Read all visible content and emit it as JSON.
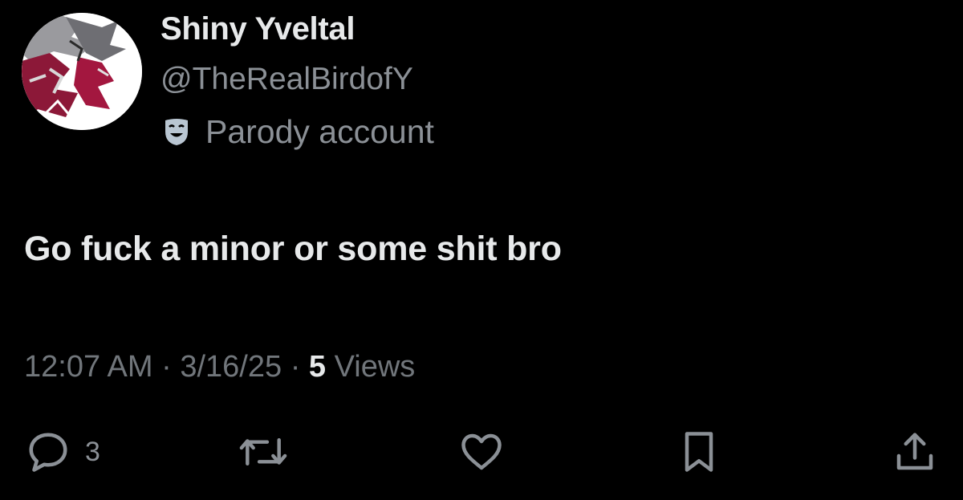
{
  "profile": {
    "display_name": "Shiny Yveltal",
    "handle": "@TheRealBirdofY",
    "label": "Parody account",
    "label_icon": "theater-mask-icon",
    "avatar": "yveltal-avatar"
  },
  "tweet": {
    "text": "Go fuck a minor or some shit bro",
    "time": "12:07 AM",
    "date": "3/16/25",
    "separator": "·",
    "views_count": "5",
    "views_label": "Views"
  },
  "actions": {
    "reply": {
      "icon": "reply-icon",
      "count": "3"
    },
    "retweet": {
      "icon": "retweet-icon"
    },
    "like": {
      "icon": "heart-icon"
    },
    "bookmark": {
      "icon": "bookmark-icon"
    },
    "share": {
      "icon": "share-icon"
    }
  },
  "colors": {
    "background": "#000000",
    "primary_text": "#e7e9ea",
    "secondary_text": "#71767b"
  }
}
